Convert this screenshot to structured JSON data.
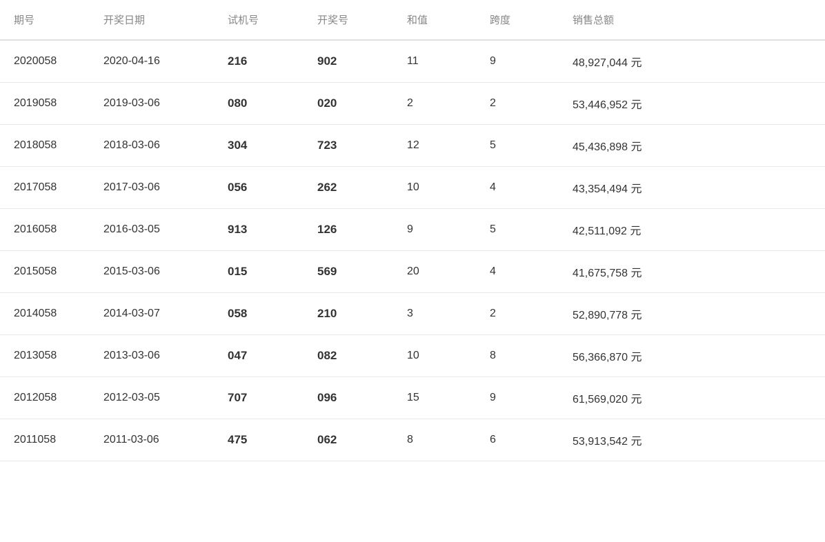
{
  "table": {
    "headers": [
      "期号",
      "开奖日期",
      "试机号",
      "开奖号",
      "和值",
      "跨度",
      "销售总额"
    ],
    "rows": [
      {
        "qihao": "2020058",
        "date": "2020-04-16",
        "shiji": "216",
        "kaijianghao": "902",
        "hezhi": "11",
        "kuadu": "9",
        "xiaoshou": "48,927,044 元"
      },
      {
        "qihao": "2019058",
        "date": "2019-03-06",
        "shiji": "080",
        "kaijianghao": "020",
        "hezhi": "2",
        "kuadu": "2",
        "xiaoshou": "53,446,952 元"
      },
      {
        "qihao": "2018058",
        "date": "2018-03-06",
        "shiji": "304",
        "kaijianghao": "723",
        "hezhi": "12",
        "kuadu": "5",
        "xiaoshou": "45,436,898 元"
      },
      {
        "qihao": "2017058",
        "date": "2017-03-06",
        "shiji": "056",
        "kaijianghao": "262",
        "hezhi": "10",
        "kuadu": "4",
        "xiaoshou": "43,354,494 元"
      },
      {
        "qihao": "2016058",
        "date": "2016-03-05",
        "shiji": "913",
        "kaijianghao": "126",
        "hezhi": "9",
        "kuadu": "5",
        "xiaoshou": "42,511,092 元"
      },
      {
        "qihao": "2015058",
        "date": "2015-03-06",
        "shiji": "015",
        "kaijianghao": "569",
        "hezhi": "20",
        "kuadu": "4",
        "xiaoshou": "41,675,758 元"
      },
      {
        "qihao": "2014058",
        "date": "2014-03-07",
        "shiji": "058",
        "kaijianghao": "210",
        "hezhi": "3",
        "kuadu": "2",
        "xiaoshou": "52,890,778 元"
      },
      {
        "qihao": "2013058",
        "date": "2013-03-06",
        "shiji": "047",
        "kaijianghao": "082",
        "hezhi": "10",
        "kuadu": "8",
        "xiaoshou": "56,366,870 元"
      },
      {
        "qihao": "2012058",
        "date": "2012-03-05",
        "shiji": "707",
        "kaijianghao": "096",
        "hezhi": "15",
        "kuadu": "9",
        "xiaoshou": "61,569,020 元"
      },
      {
        "qihao": "2011058",
        "date": "2011-03-06",
        "shiji": "475",
        "kaijianghao": "062",
        "hezhi": "8",
        "kuadu": "6",
        "xiaoshou": "53,913,542 元"
      }
    ]
  }
}
